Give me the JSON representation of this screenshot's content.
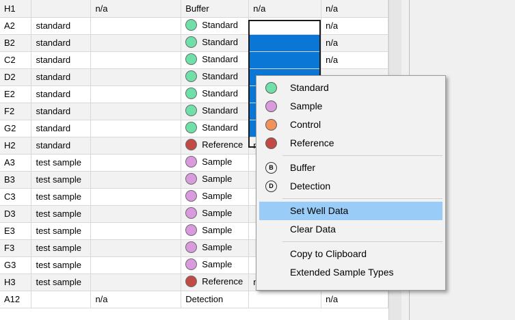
{
  "columns": [
    "well",
    "description",
    "value",
    "type",
    "status",
    "extra"
  ],
  "type_colors": {
    "Standard": "#6ee0a8",
    "Sample": "#d99bde",
    "Reference": "#c24a45",
    "Control": "#f2925a"
  },
  "rows": [
    {
      "well": "H1",
      "desc": "",
      "c3": "n/a",
      "type": "Buffer",
      "dot": "",
      "c5": "n/a",
      "c6": "n/a"
    },
    {
      "well": "A2",
      "desc": "standard",
      "c3": "",
      "type": "Standard",
      "dot": "Standard",
      "c5": "",
      "c6": "n/a"
    },
    {
      "well": "B2",
      "desc": "standard",
      "c3": "",
      "type": "Standard",
      "dot": "Standard",
      "c5": "",
      "c6": "n/a"
    },
    {
      "well": "C2",
      "desc": "standard",
      "c3": "",
      "type": "Standard",
      "dot": "Standard",
      "c5": "",
      "c6": "n/a"
    },
    {
      "well": "D2",
      "desc": "standard",
      "c3": "",
      "type": "Standard",
      "dot": "Standard",
      "c5": "",
      "c6": ""
    },
    {
      "well": "E2",
      "desc": "standard",
      "c3": "",
      "type": "Standard",
      "dot": "Standard",
      "c5": "",
      "c6": ""
    },
    {
      "well": "F2",
      "desc": "standard",
      "c3": "",
      "type": "Standard",
      "dot": "Standard",
      "c5": "",
      "c6": ""
    },
    {
      "well": "G2",
      "desc": "standard",
      "c3": "",
      "type": "Standard",
      "dot": "Standard",
      "c5": "",
      "c6": ""
    },
    {
      "well": "H2",
      "desc": "standard",
      "c3": "",
      "type": "Reference",
      "dot": "Reference",
      "c5": "n",
      "c6": ""
    },
    {
      "well": "A3",
      "desc": "test sample",
      "c3": "",
      "type": "Sample",
      "dot": "Sample",
      "c5": "",
      "c6": ""
    },
    {
      "well": "B3",
      "desc": "test sample",
      "c3": "",
      "type": "Sample",
      "dot": "Sample",
      "c5": "",
      "c6": ""
    },
    {
      "well": "C3",
      "desc": "test sample",
      "c3": "",
      "type": "Sample",
      "dot": "Sample",
      "c5": "",
      "c6": ""
    },
    {
      "well": "D3",
      "desc": "test sample",
      "c3": "",
      "type": "Sample",
      "dot": "Sample",
      "c5": "",
      "c6": ""
    },
    {
      "well": "E3",
      "desc": "test sample",
      "c3": "",
      "type": "Sample",
      "dot": "Sample",
      "c5": "",
      "c6": ""
    },
    {
      "well": "F3",
      "desc": "test sample",
      "c3": "",
      "type": "Sample",
      "dot": "Sample",
      "c5": "",
      "c6": ""
    },
    {
      "well": "G3",
      "desc": "test sample",
      "c3": "",
      "type": "Sample",
      "dot": "Sample",
      "c5": "",
      "c6": ""
    },
    {
      "well": "H3",
      "desc": "test sample",
      "c3": "",
      "type": "Reference",
      "dot": "Reference",
      "c5": "n/a",
      "c6": "n/a"
    },
    {
      "well": "A12",
      "desc": "",
      "c3": "n/a",
      "type": "Detection",
      "dot": "",
      "c5": "",
      "c6": "n/a"
    }
  ],
  "context_menu": {
    "groups": [
      [
        {
          "label": "Standard",
          "icon": "dot",
          "color": "#6ee0a8",
          "name": "standard"
        },
        {
          "label": "Sample",
          "icon": "dot",
          "color": "#d99bde",
          "name": "sample"
        },
        {
          "label": "Control",
          "icon": "dot",
          "color": "#f2925a",
          "name": "control"
        },
        {
          "label": "Reference",
          "icon": "dot",
          "color": "#c24a45",
          "name": "reference"
        }
      ],
      [
        {
          "label": "Buffer",
          "icon": "letter",
          "letter": "B",
          "name": "buffer"
        },
        {
          "label": "Detection",
          "icon": "letter",
          "letter": "D",
          "name": "detection"
        }
      ],
      [
        {
          "label": "Set Well Data",
          "icon": "none",
          "name": "set-well-data",
          "highlighted": true
        },
        {
          "label": "Clear Data",
          "icon": "none",
          "name": "clear-data"
        }
      ],
      [
        {
          "label": "Copy to Clipboard",
          "icon": "none",
          "name": "copy-to-clipboard"
        },
        {
          "label": "Extended Sample Types",
          "icon": "none",
          "name": "extended-sample-types"
        }
      ]
    ]
  }
}
